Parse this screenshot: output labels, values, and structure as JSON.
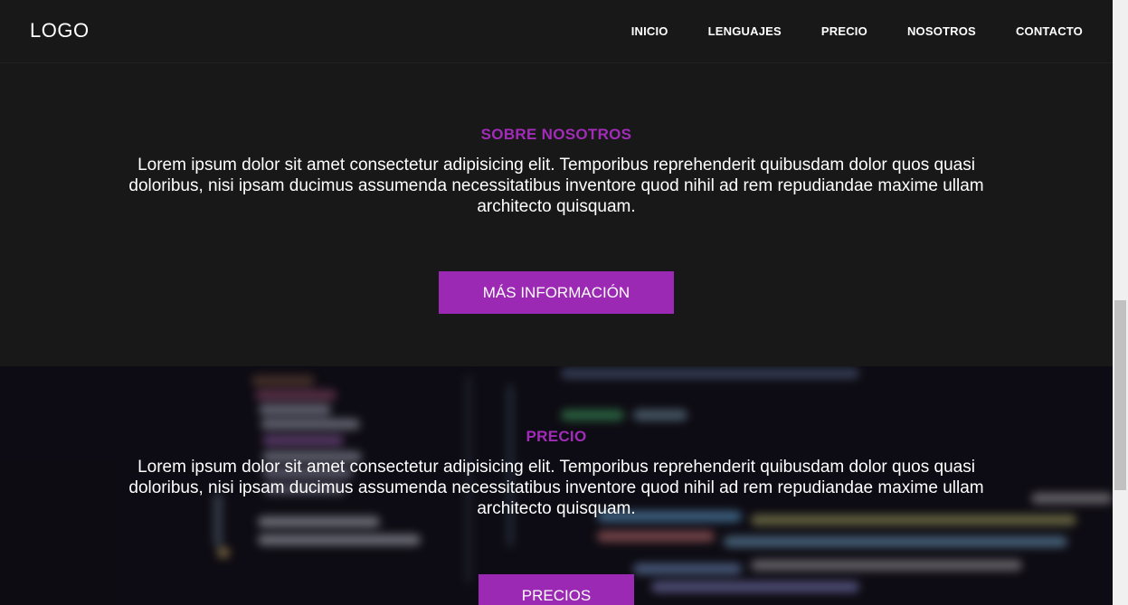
{
  "header": {
    "logo": "LOGO",
    "nav": [
      "INICIO",
      "LENGUAJES",
      "PRECIO",
      "NOSOTROS",
      "CONTACTO"
    ]
  },
  "about": {
    "title": "SOBRE NOSOTROS",
    "text": "Lorem ipsum dolor sit amet consectetur adipisicing elit. Temporibus reprehenderit quibusdam dolor quos quasi doloribus, nisi ipsam ducimus assumenda necessitatibus inventore quod nihil ad rem repudiandae maxime ullam architecto quisquam.",
    "button": "MÁS INFORMACIÓN"
  },
  "pricing": {
    "title": "PRECIO",
    "text": "Lorem ipsum dolor sit amet consectetur adipisicing elit. Temporibus reprehenderit quibusdam dolor quos quasi doloribus, nisi ipsam ducimus assumenda necessitatibus inventore quod nihil ad rem repudiandae maxime ullam architecto quisquam.",
    "button": "PRECIOS"
  },
  "colors": {
    "accent": "#9b29b3",
    "title": "#a32bb9",
    "background": "#181818"
  }
}
